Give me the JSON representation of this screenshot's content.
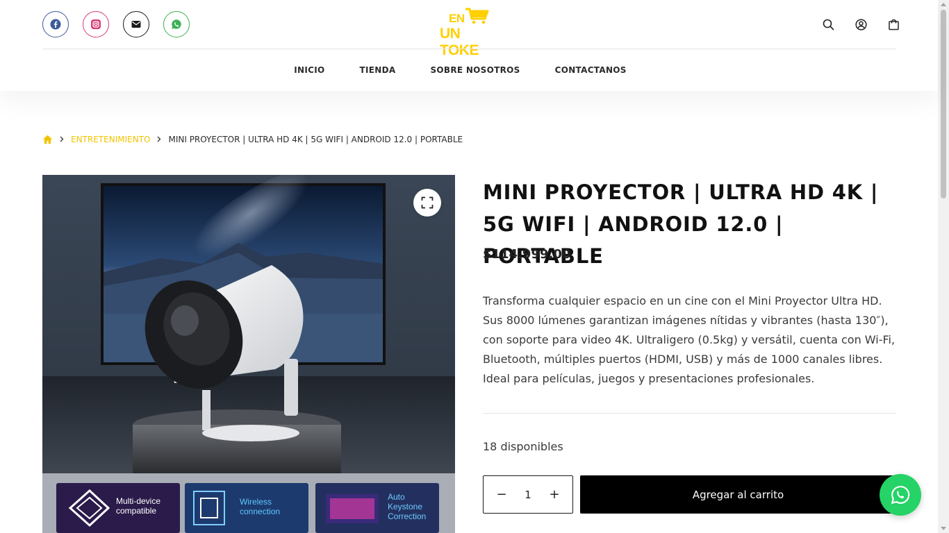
{
  "header": {
    "socials": [
      {
        "name": "facebook-icon",
        "color": "#3b5a99"
      },
      {
        "name": "instagram-icon",
        "color": "#d63a77"
      },
      {
        "name": "mail-icon",
        "color": "#1b1b1b"
      },
      {
        "name": "whatsapp-icon",
        "color": "#3bb054"
      }
    ],
    "logo": {
      "line1": "EN",
      "line2": "UN TOKE",
      "color": "#ffcf00"
    },
    "icons": [
      "search-icon",
      "user-icon",
      "cart-icon"
    ]
  },
  "nav": {
    "items": [
      "INICIO",
      "TIENDA",
      "SOBRE NOSOTROS",
      "CONTACTANOS"
    ]
  },
  "breadcrumb": {
    "category": "ENTRETENIMIENTO",
    "current": "MINI PROYECTOR | ULTRA HD 4K | 5G WIFI | ANDROID 12.0 | PORTABLE"
  },
  "gallery": {
    "features": [
      "Multi-device compatible",
      "Wireless connection",
      "Auto Keystone Correction"
    ]
  },
  "product": {
    "title": "MINI PROYECTOR | ULTRA HD 4K | 5G WIFI | ANDROID 12.0 | PORTABLE",
    "price": "$114.999,00",
    "description": "Transforma cualquier espacio en un cine con el Mini Proyector Ultra HD. Sus 8000 lúmenes garantizan imágenes nítidas y vibrantes (hasta 130″), con soporte para video 4K. Ultraligero (0.5kg) y versátil, cuenta con Wi-Fi, Bluetooth, múltiples puertos (HDMI, USB) y más de 1000 canales libres. Ideal para películas, juegos y presentaciones profesionales.",
    "stock": "18 disponibles",
    "quantity": "1",
    "add_to_cart": "Agregar al carrito"
  },
  "colors": {
    "accent": "#f2c400",
    "button_bg": "#000000",
    "whatsapp": "#25d366"
  }
}
